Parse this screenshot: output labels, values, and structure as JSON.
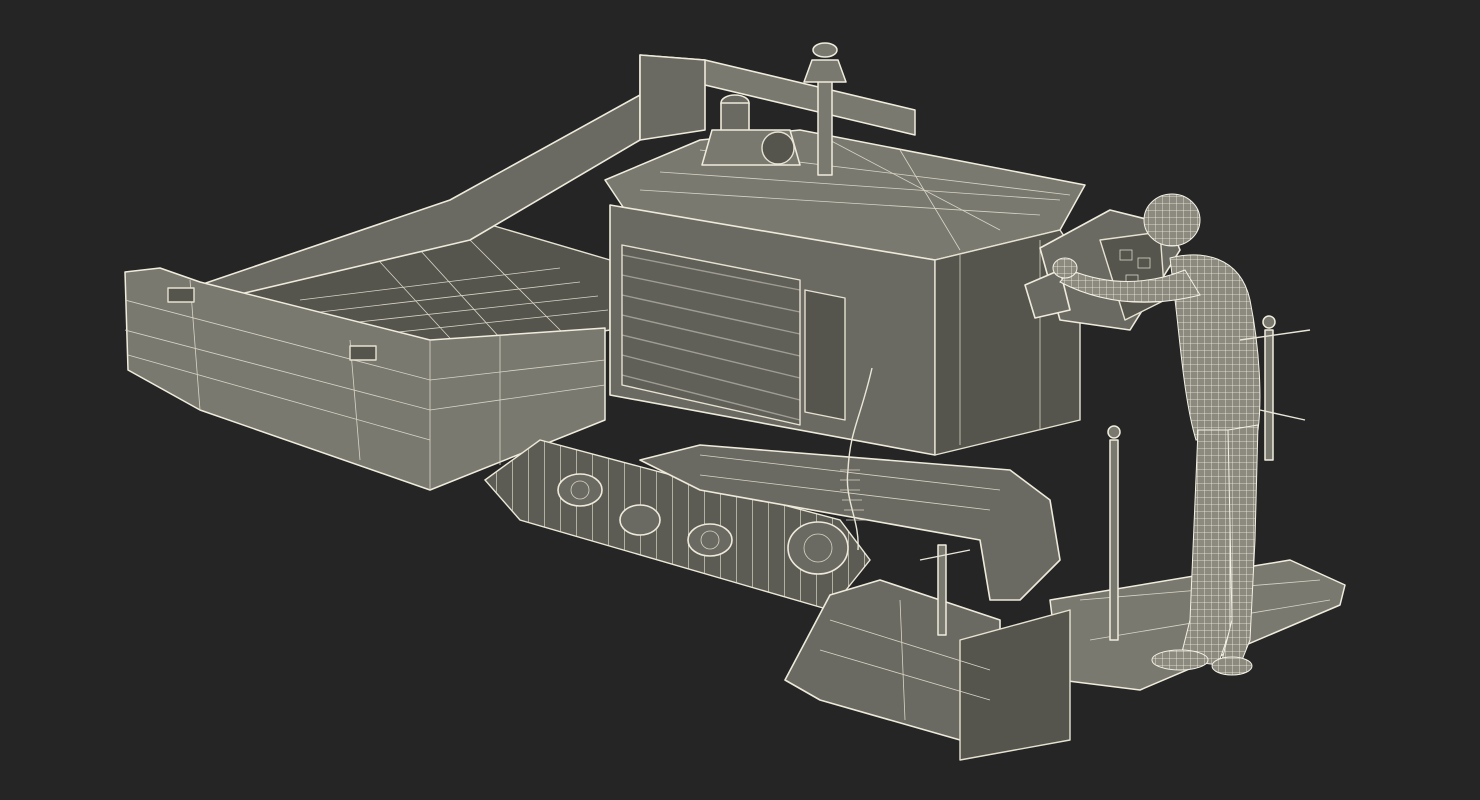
{
  "scene": {
    "background_color": "#252525",
    "wire_color": "#e9e6d8",
    "surface_color": "#6b6a62",
    "objects": [
      {
        "name": "asphalt-paver",
        "render_style": "wireframe-over-shaded"
      },
      {
        "name": "worker",
        "render_style": "wireframe-mesh"
      }
    ]
  }
}
